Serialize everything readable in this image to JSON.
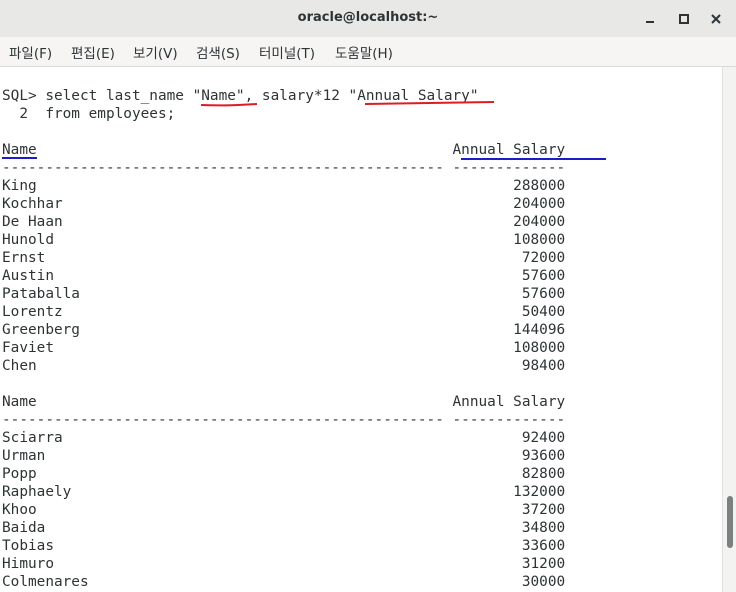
{
  "window": {
    "title": "oracle@localhost:~",
    "controls": [
      "minimize-icon",
      "maximize-icon",
      "close-icon"
    ]
  },
  "menu": [
    "파일(F)",
    "편집(E)",
    "보기(V)",
    "검색(S)",
    "터미널(T)",
    "도움말(H)"
  ],
  "terminal": {
    "lines": [
      "SQL> select last_name \"Name\", salary*12 \"Annual Salary\"",
      "  2  from employees;",
      "",
      "Name                                                Annual Salary",
      "--------------------------------------------------- -------------",
      "King                                                       288000",
      "Kochhar                                                    204000",
      "De Haan                                                    204000",
      "Hunold                                                     108000",
      "Ernst                                                       72000",
      "Austin                                                      57600",
      "Pataballa                                                   57600",
      "Lorentz                                                     50400",
      "Greenberg                                                  144096",
      "Faviet                                                     108000",
      "Chen                                                        98400",
      "",
      "Name                                                Annual Salary",
      "--------------------------------------------------- -------------",
      "Sciarra                                                     92400",
      "Urman                                                       93600",
      "Popp                                                        82800",
      "Raphaely                                                   132000",
      "Khoo                                                        37200",
      "Baida                                                       34800",
      "Tobias                                                      33600",
      "Himuro                                                      31200",
      "Colmenares                                                  30000"
    ]
  },
  "annotations": {
    "red_underline_color": "#e01b24",
    "blue_underline_color": "#1c1cc8"
  }
}
